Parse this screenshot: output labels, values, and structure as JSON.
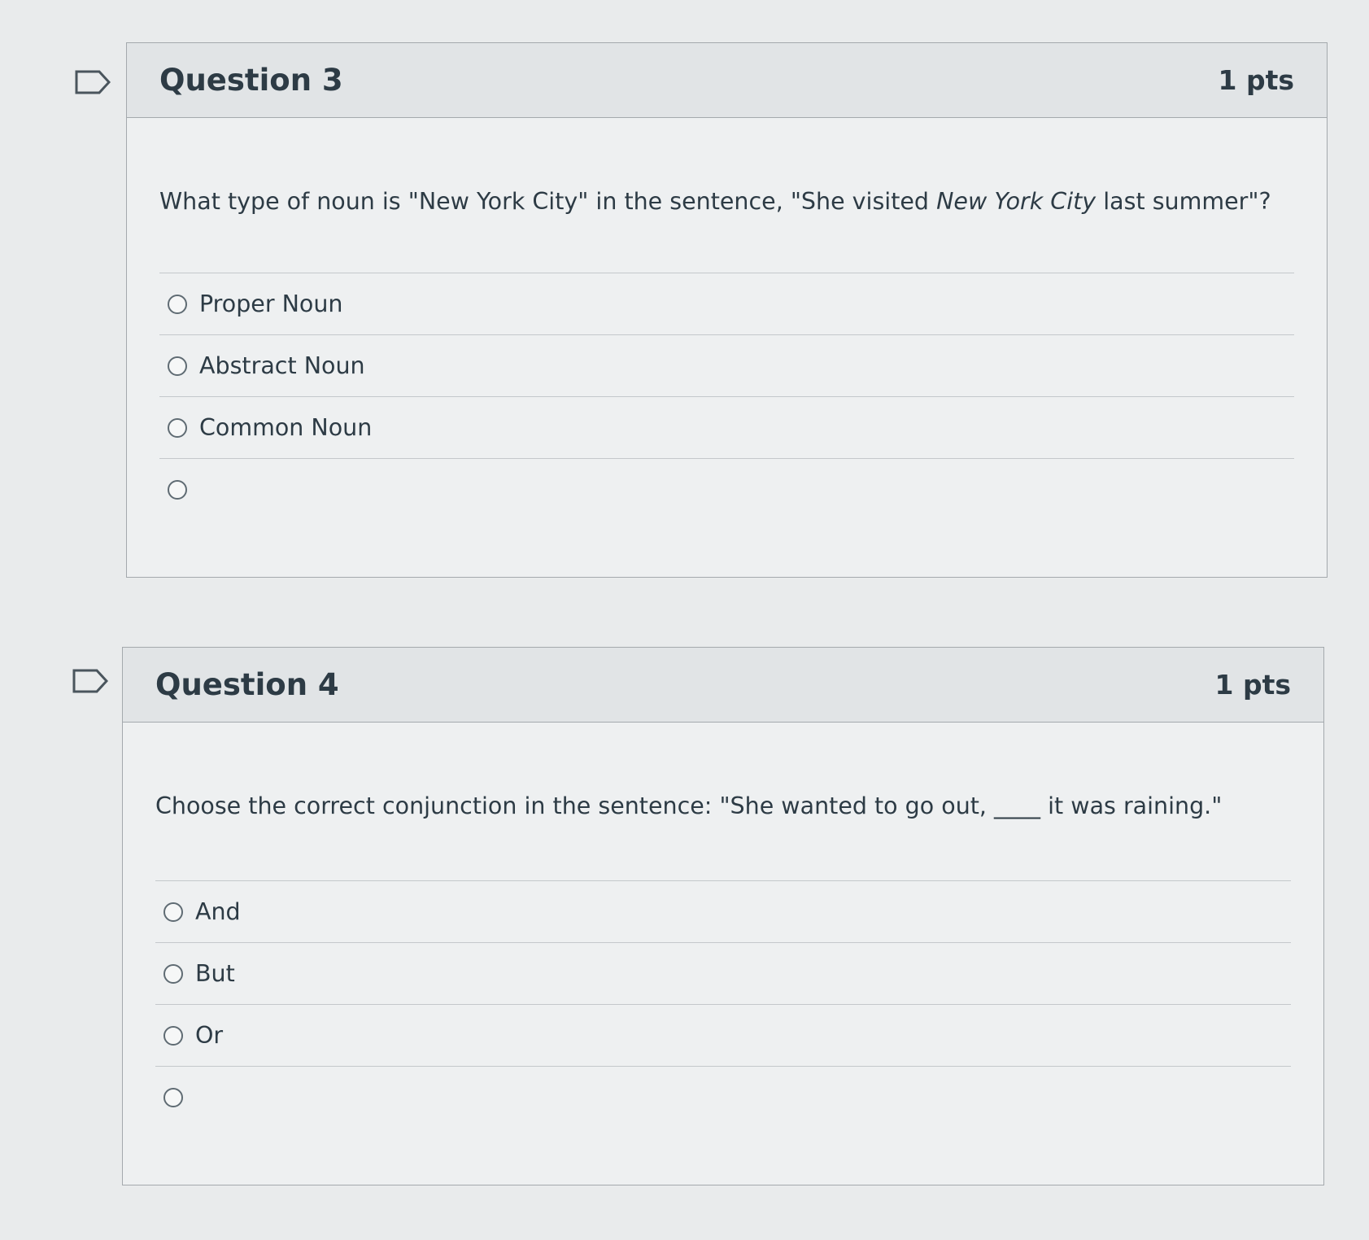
{
  "questions": [
    {
      "title": "Question 3",
      "points": "1 pts",
      "text_before": "What type of noun is \"New York City\" in the sentence, \"She visited ",
      "text_emphasis": "New York City",
      "text_after": " last summer\"?",
      "answers": [
        "Proper Noun",
        "Abstract Noun",
        "Common Noun",
        ""
      ]
    },
    {
      "title": "Question 4",
      "points": "1 pts",
      "text": "Choose the correct conjunction in the sentence: \"She wanted to go out, ____ it was raining.\"",
      "answers": [
        "And",
        "But",
        "Or",
        ""
      ]
    }
  ],
  "icons": {
    "flag": "flag-question-icon",
    "radio": "radio-unselected"
  },
  "colors": {
    "background": "#e9ebec",
    "header": "#e1e4e6",
    "text": "#2d3b45",
    "border": "#a4a9ad"
  }
}
